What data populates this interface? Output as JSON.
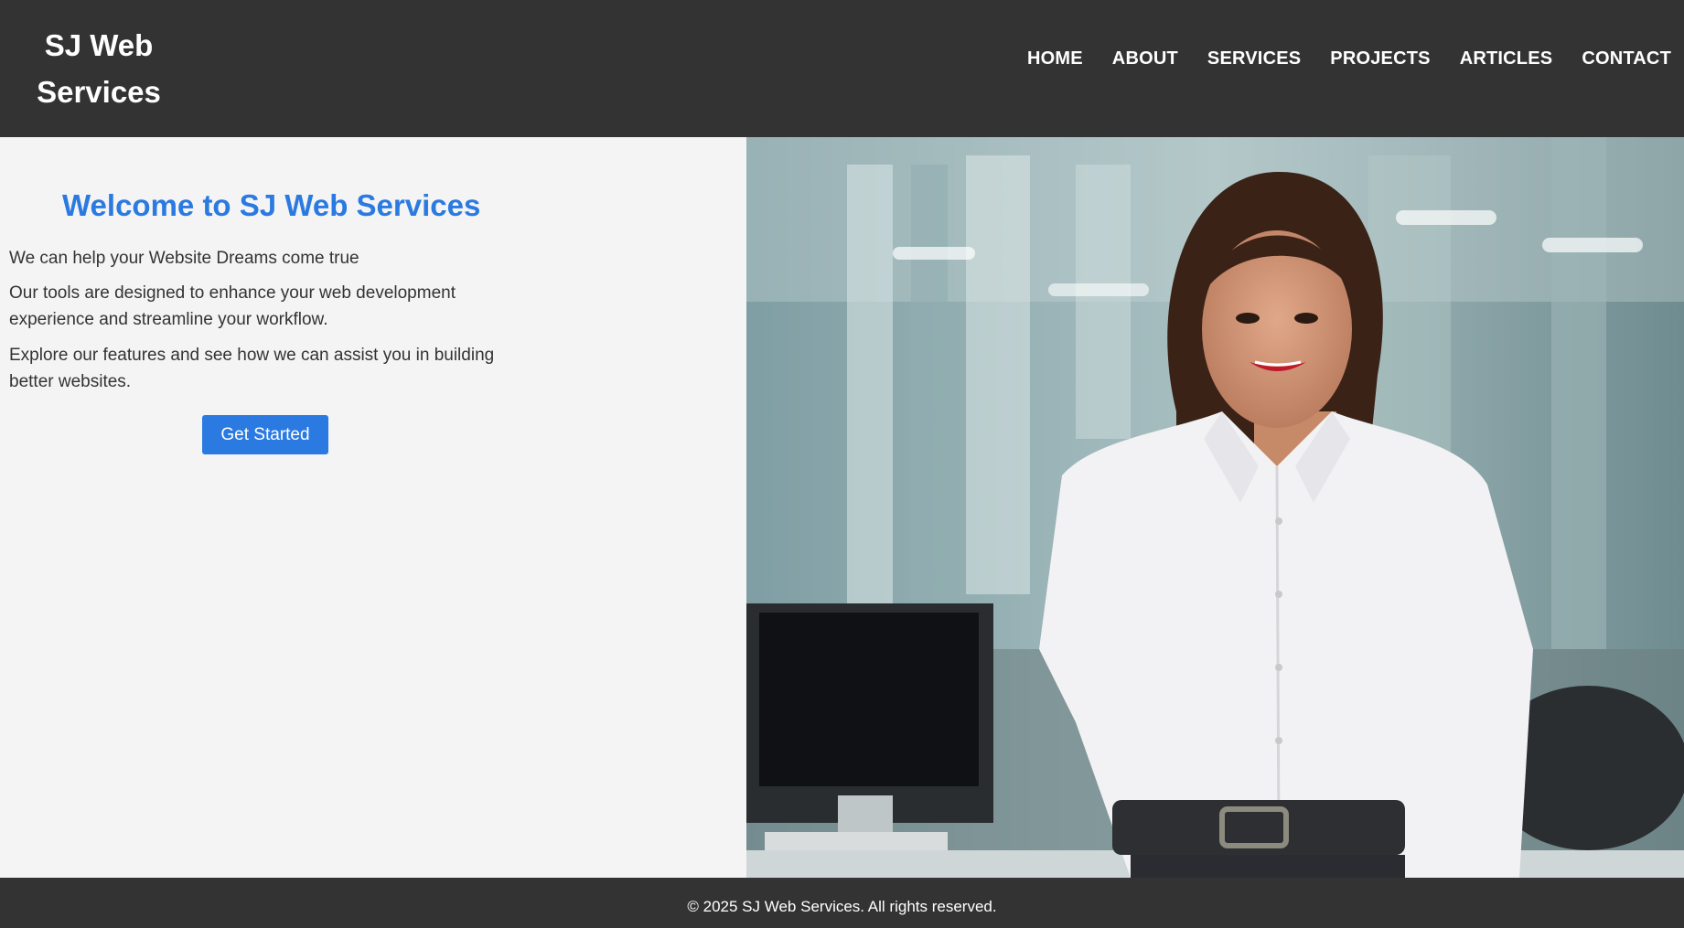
{
  "header": {
    "brand": "SJ Web Services",
    "nav": [
      "HOME",
      "ABOUT",
      "SERVICES",
      "PROJECTS",
      "ARTICLES",
      "CONTACT"
    ]
  },
  "hero": {
    "title": "Welcome to SJ Web Services",
    "paragraphs": [
      "We can help your Website Dreams come true",
      "Our tools are designed to enhance your web development experience and streamline your workflow.",
      "Explore our features and see how we can assist you in building better websites."
    ],
    "cta_label": "Get Started"
  },
  "footer": {
    "copyright": "© 2025 SJ Web Services. All rights reserved."
  },
  "colors": {
    "header_bg": "#333333",
    "accent": "#2a7ae2",
    "page_bg": "#f4f4f4"
  }
}
